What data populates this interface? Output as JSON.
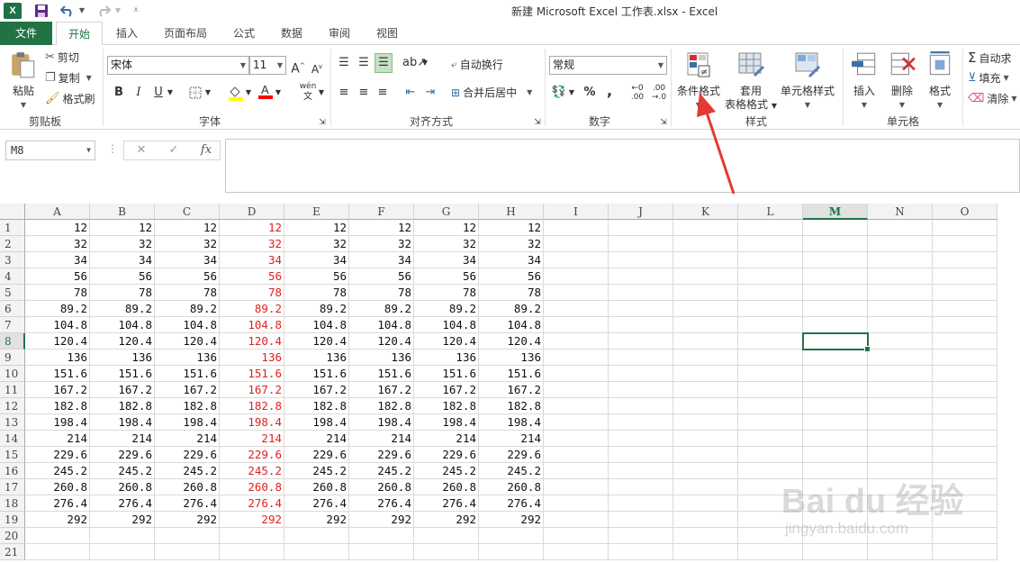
{
  "window": {
    "title": "新建 Microsoft Excel 工作表.xlsx - Excel"
  },
  "quick_access": {
    "logo": "X",
    "save_icon": "save-icon",
    "undo_icon": "undo-icon",
    "redo_icon": "redo-icon",
    "customize_icon": "customize-icon"
  },
  "tabs": {
    "file": "文件",
    "items": [
      "开始",
      "插入",
      "页面布局",
      "公式",
      "数据",
      "审阅",
      "视图"
    ],
    "active": "开始"
  },
  "ribbon": {
    "clipboard": {
      "paste": "粘贴",
      "cut": "剪切",
      "copy": "复制",
      "format_painter": "格式刷",
      "label": "剪贴板"
    },
    "font": {
      "name": "宋体",
      "size": "11",
      "bold": "B",
      "italic": "I",
      "underline": "U",
      "phonetic": "wén",
      "grow": "A",
      "shrink": "A",
      "label": "字体",
      "fill_color": "#ffff00",
      "font_color": "#ff0000"
    },
    "alignment": {
      "wrap": "自动换行",
      "merge": "合并后居中",
      "label": "对齐方式"
    },
    "number": {
      "format": "常规",
      "percent": "%",
      "comma": ",",
      "label": "数字"
    },
    "styles": {
      "conditional": "条件格式",
      "table_line1": "套用",
      "table_line2": "表格格式",
      "cell_styles": "单元格样式",
      "label": "样式"
    },
    "cells": {
      "insert": "插入",
      "delete": "删除",
      "format": "格式",
      "label": "单元格"
    },
    "editing": {
      "autosum": "自动求",
      "fill": "填充",
      "clear": "清除"
    }
  },
  "formula_bar": {
    "name_box": "M8",
    "cancel": "✕",
    "enter": "✓",
    "fx": "fx",
    "formula": ""
  },
  "sheet": {
    "columns": [
      "A",
      "B",
      "C",
      "D",
      "E",
      "F",
      "G",
      "H",
      "I",
      "J",
      "K",
      "L",
      "M",
      "N",
      "O"
    ],
    "selected_column": "M",
    "selected_row": 8,
    "rows": [
      [
        "12",
        "12",
        "12",
        "12",
        "12",
        "12",
        "12",
        "12"
      ],
      [
        "32",
        "32",
        "32",
        "32",
        "32",
        "32",
        "32",
        "32"
      ],
      [
        "34",
        "34",
        "34",
        "34",
        "34",
        "34",
        "34",
        "34"
      ],
      [
        "56",
        "56",
        "56",
        "56",
        "56",
        "56",
        "56",
        "56"
      ],
      [
        "78",
        "78",
        "78",
        "78",
        "78",
        "78",
        "78",
        "78"
      ],
      [
        "89.2",
        "89.2",
        "89.2",
        "89.2",
        "89.2",
        "89.2",
        "89.2",
        "89.2"
      ],
      [
        "104.8",
        "104.8",
        "104.8",
        "104.8",
        "104.8",
        "104.8",
        "104.8",
        "104.8"
      ],
      [
        "120.4",
        "120.4",
        "120.4",
        "120.4",
        "120.4",
        "120.4",
        "120.4",
        "120.4"
      ],
      [
        "136",
        "136",
        "136",
        "136",
        "136",
        "136",
        "136",
        "136"
      ],
      [
        "151.6",
        "151.6",
        "151.6",
        "151.6",
        "151.6",
        "151.6",
        "151.6",
        "151.6"
      ],
      [
        "167.2",
        "167.2",
        "167.2",
        "167.2",
        "167.2",
        "167.2",
        "167.2",
        "167.2"
      ],
      [
        "182.8",
        "182.8",
        "182.8",
        "182.8",
        "182.8",
        "182.8",
        "182.8",
        "182.8"
      ],
      [
        "198.4",
        "198.4",
        "198.4",
        "198.4",
        "198.4",
        "198.4",
        "198.4",
        "198.4"
      ],
      [
        "214",
        "214",
        "214",
        "214",
        "214",
        "214",
        "214",
        "214"
      ],
      [
        "229.6",
        "229.6",
        "229.6",
        "229.6",
        "229.6",
        "229.6",
        "229.6",
        "229.6"
      ],
      [
        "245.2",
        "245.2",
        "245.2",
        "245.2",
        "245.2",
        "245.2",
        "245.2",
        "245.2"
      ],
      [
        "260.8",
        "260.8",
        "260.8",
        "260.8",
        "260.8",
        "260.8",
        "260.8",
        "260.8"
      ],
      [
        "276.4",
        "276.4",
        "276.4",
        "276.4",
        "276.4",
        "276.4",
        "276.4",
        "276.4"
      ],
      [
        "292",
        "292",
        "292",
        "292",
        "292",
        "292",
        "292",
        "292"
      ],
      [
        "",
        "",
        "",
        "",
        "",
        "",
        "",
        ""
      ],
      [
        "",
        "",
        "",
        "",
        "",
        "",
        "",
        ""
      ]
    ],
    "red_column": "D",
    "red_color": "#e02020",
    "accent_color": "#217346"
  },
  "watermark": {
    "brand": "Bai du 经验",
    "url": "jingyan.baidu.com"
  }
}
